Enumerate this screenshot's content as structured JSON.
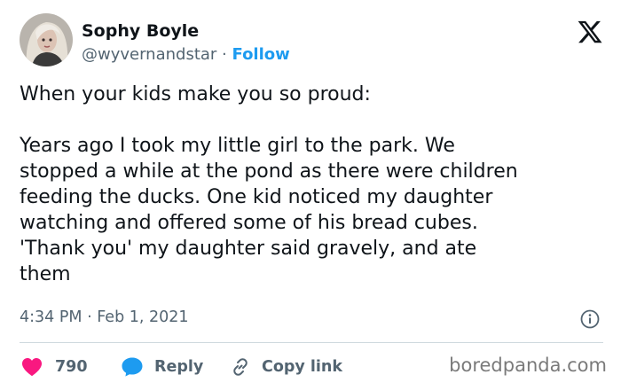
{
  "author": {
    "display_name": "Sophy Boyle",
    "handle": "@wyvernandstar",
    "separator": " · ",
    "follow_label": "Follow"
  },
  "tweet": {
    "lines_intro": [
      "When your kids make you so proud:"
    ],
    "lines_body": [
      "Years ago I took my little girl to the park. We",
      "stopped a while at the pond as there were children",
      "feeding the ducks. One kid noticed my daughter",
      "watching and offered some of his bread cubes.",
      "'Thank you' my daughter said gravely, and ate",
      "them"
    ],
    "timestamp": "4:34 PM · Feb 1, 2021"
  },
  "actions": {
    "like_count": "790",
    "reply_label": "Reply",
    "copy_label": "Copy link"
  },
  "watermark": "boredpanda.com",
  "colors": {
    "accent": "#1d9bf0",
    "like": "#f91880",
    "text": "#0f1419",
    "muted": "#536471"
  },
  "icons": [
    "x-logo-icon",
    "info-icon",
    "heart-icon",
    "reply-bubble-icon",
    "link-icon"
  ]
}
